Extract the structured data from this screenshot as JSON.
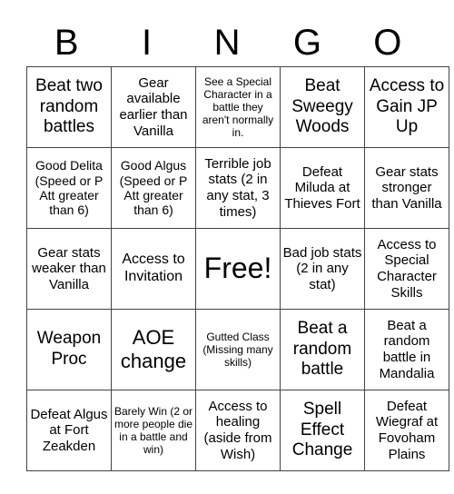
{
  "header": {
    "letters": [
      "B",
      "I",
      "N",
      "G",
      "O"
    ]
  },
  "rows": [
    [
      "Beat two random battles",
      "Gear available earlier than Vanilla",
      "See a Special Character in a battle they aren't normally in.",
      "Beat Sweegy Woods",
      "Access to Gain JP Up"
    ],
    [
      "Good Delita (Speed or P Att greater than 6)",
      "Good Algus (Speed or P Att greater than 6)",
      "Terrible job stats (2 in any stat, 3 times)",
      "Defeat Miluda at Thieves Fort",
      "Gear stats stronger than Vanilla"
    ],
    [
      "Gear stats weaker than Vanilla",
      "Access to Invitation",
      "Free!",
      "Bad job stats (2 in any stat)",
      "Access to Special Character Skills"
    ],
    [
      "Weapon Proc",
      "AOE change",
      "Gutted Class (Missing many skills)",
      "Beat a random battle",
      "Beat a random battle in Mandalia"
    ],
    [
      "Defeat Algus at Fort Zeakden",
      "Barely Win (2 or more people die in a battle and win)",
      "Access to healing (aside from Wish)",
      "Spell Effect Change",
      "Defeat Wiegraf at Fovoham Plains"
    ]
  ]
}
